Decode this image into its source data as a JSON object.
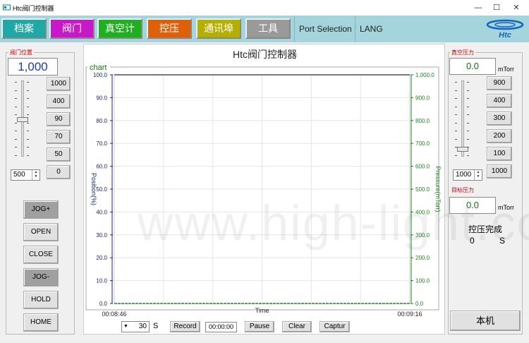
{
  "titlebar": {
    "title": "Htc阀门控制器",
    "minimize": "—",
    "maximize": "☐",
    "close": "✕"
  },
  "toolbar": {
    "tabs": [
      {
        "label": "档案",
        "color": "#1fa8a6"
      },
      {
        "label": "阀门",
        "color": "#c918c9"
      },
      {
        "label": "真空计",
        "color": "#1fb01f"
      },
      {
        "label": "控压",
        "color": "#e0600a"
      },
      {
        "label": "通讯埠",
        "color": "#b5b000"
      },
      {
        "label": "工具",
        "color": "#9a9a9a"
      }
    ],
    "port_selection": "Port Selection",
    "lang": "LANG",
    "logo_text": "Htc"
  },
  "valve": {
    "group_label": "阀门位置",
    "position_value": "1,000",
    "preset_buttons": [
      "1000",
      "400",
      "90",
      "70",
      "50",
      "0"
    ],
    "spin_value": "500",
    "slider_fraction": 0.5,
    "action_buttons": [
      "JOG+",
      "OPEN",
      "CLOSE",
      "JOG-",
      "HOLD",
      "HOME"
    ]
  },
  "center": {
    "heading": "Htc阀门控制器",
    "chart_label": "chart",
    "bottom": {
      "interval_value": "30",
      "interval_unit": "S",
      "record": "Record",
      "timer": "00:00:00",
      "pause": "Pause",
      "clear": "Clear",
      "capture": "Captur"
    }
  },
  "vacuum": {
    "group_label": "真空压力",
    "value": "0.0",
    "unit": "mTorr",
    "preset_buttons": [
      "900",
      "400",
      "300",
      "200",
      "100",
      "1000"
    ],
    "spin_value": "1000",
    "slider_fraction": 0.1,
    "target_label": "目标压力",
    "target_value": "0.0",
    "target_unit": "mTorr",
    "complete_label": "控压完成",
    "complete_value": "0",
    "complete_unit": "S",
    "local_button": "本机"
  },
  "watermark": "www.high-light.com.tw",
  "chart_data": {
    "type": "line",
    "x": [
      "00:08:46",
      "00:09:16"
    ],
    "xlabel": "Time",
    "ylabel": "Position(%)",
    "y2label": "Pressure(mTorr)",
    "ylim": [
      0,
      100
    ],
    "y2lim": [
      0,
      1000
    ],
    "yticks": [
      "0.0",
      "10.0",
      "20.0",
      "30.0",
      "40.0",
      "50.0",
      "60.0",
      "70.0",
      "80.0",
      "90.0",
      "100.0"
    ],
    "y2ticks": [
      "0.0",
      "100.0",
      "200.0",
      "300.0",
      "400.0",
      "500.0",
      "600.0",
      "700.0",
      "800.0",
      "900.0",
      "1,000.0"
    ],
    "series": [
      {
        "values": [
          100,
          100
        ],
        "color": "#1a237e",
        "axis": "left"
      },
      {
        "values": [
          0,
          0
        ],
        "color": "#1a8a1a",
        "axis": "right"
      }
    ],
    "grid": true
  }
}
